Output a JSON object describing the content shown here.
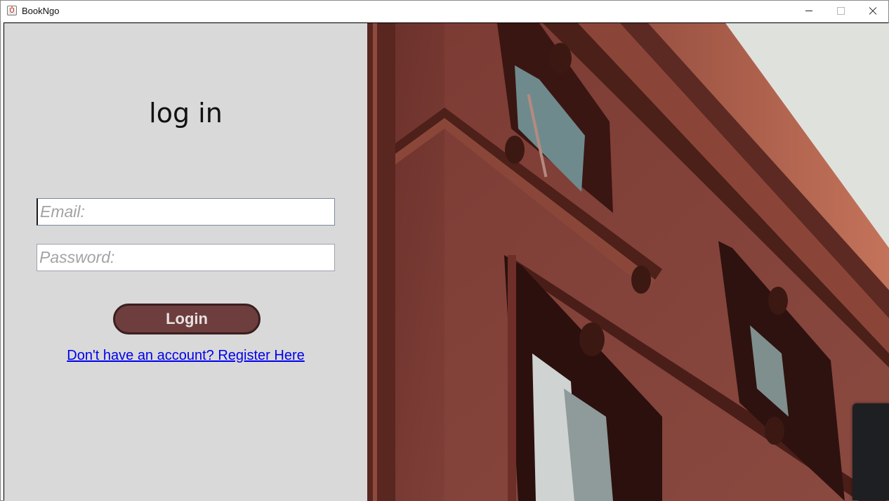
{
  "window": {
    "title": "BookNgo",
    "icon": "java-cup-icon"
  },
  "login": {
    "heading": "log in",
    "email_placeholder": "Email:",
    "password_placeholder": "Password:",
    "button_label": "Login",
    "register_link": "Don't have an account? Register Here"
  },
  "photo": {
    "subject": "building-facade-photo"
  },
  "colors": {
    "panel_bg": "#d9d9d9",
    "button_fill": "#6e3e3e",
    "button_border": "#3b1f1f",
    "link": "#0000ee",
    "wall": "#7a3d36"
  }
}
